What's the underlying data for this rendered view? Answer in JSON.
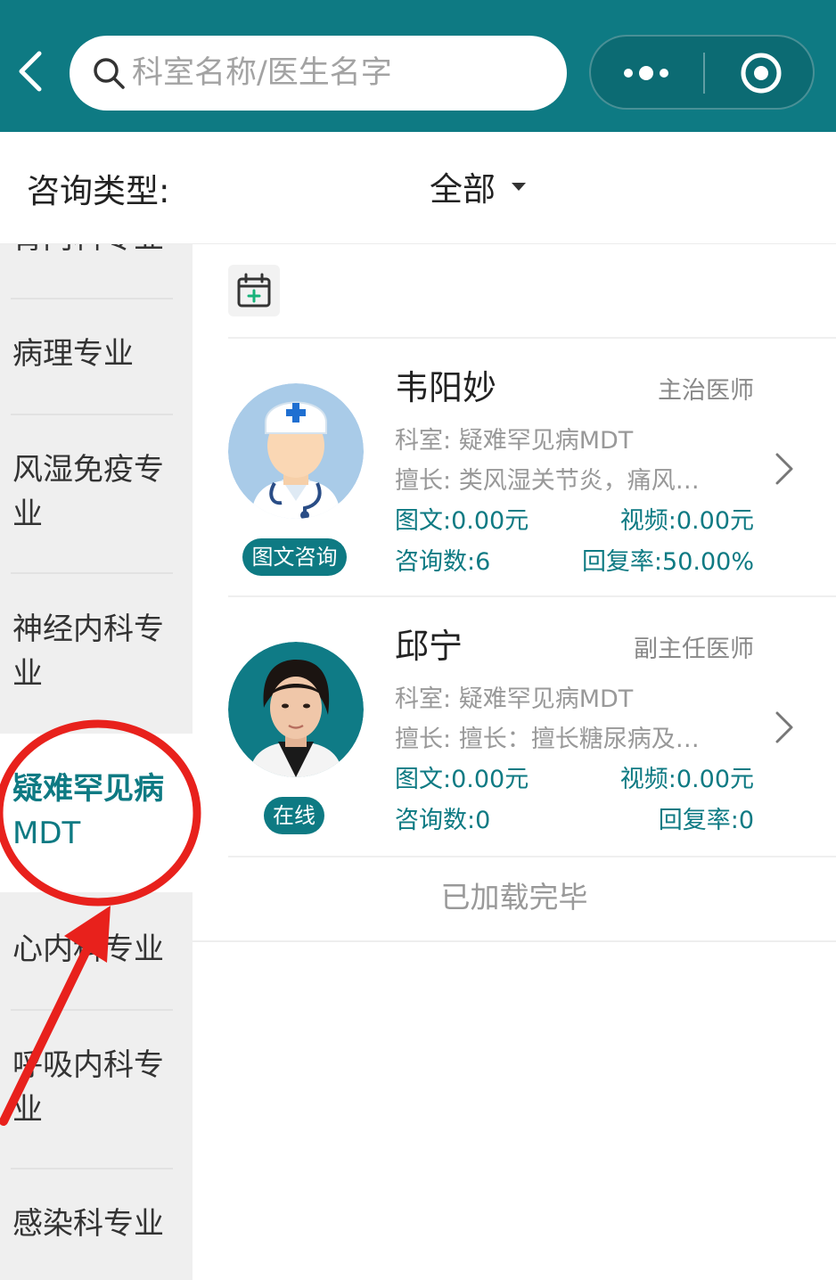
{
  "header": {
    "search_placeholder": "科室名称/医生名字",
    "background_color": "#0e7a83"
  },
  "filter": {
    "label": "咨询类型:",
    "selected": "全部"
  },
  "sidebar": {
    "items": [
      {
        "label": "肾内科专业"
      },
      {
        "label": "病理专业"
      },
      {
        "label": "风湿免疫专业",
        "line1": "风湿免疫专",
        "line2": "业"
      },
      {
        "label": "神经内科专业",
        "line1": "神经内科专",
        "line2": "业"
      },
      {
        "label": "疑难罕见病MDT",
        "line1": "疑难罕见病",
        "line2": "MDT",
        "active": true
      },
      {
        "label": "心内科专业"
      },
      {
        "label": "呼吸内科专业",
        "line1": "呼吸内科专",
        "line2": "业"
      },
      {
        "label": "感染科专业"
      }
    ]
  },
  "doctors": [
    {
      "name": "韦阳妙",
      "title": "主治医师",
      "dept_label": "科室:",
      "dept": "疑难罕见病MDT",
      "specialty_label": "擅长:",
      "specialty": "类风湿关节炎，痛风…",
      "text_price": "图文:0.00元",
      "video_price": "视频:0.00元",
      "consult_count": "咨询数:6",
      "reply_rate": "回复率:50.00%",
      "badge": "图文咨询",
      "avatar_icon": "doctor-cartoon-icon"
    },
    {
      "name": "邱宁",
      "title": "副主任医师",
      "dept_label": "科室:",
      "dept": "疑难罕见病MDT",
      "specialty_label": "擅长:",
      "specialty": "擅长：擅长糖尿病及…",
      "text_price": "图文:0.00元",
      "video_price": "视频:0.00元",
      "consult_count": "咨询数:0",
      "reply_rate": "回复率:0",
      "badge": "在线",
      "avatar_icon": "doctor-photo"
    }
  ],
  "footer_text": "已加载完毕",
  "annotation_color": "#e8211c"
}
